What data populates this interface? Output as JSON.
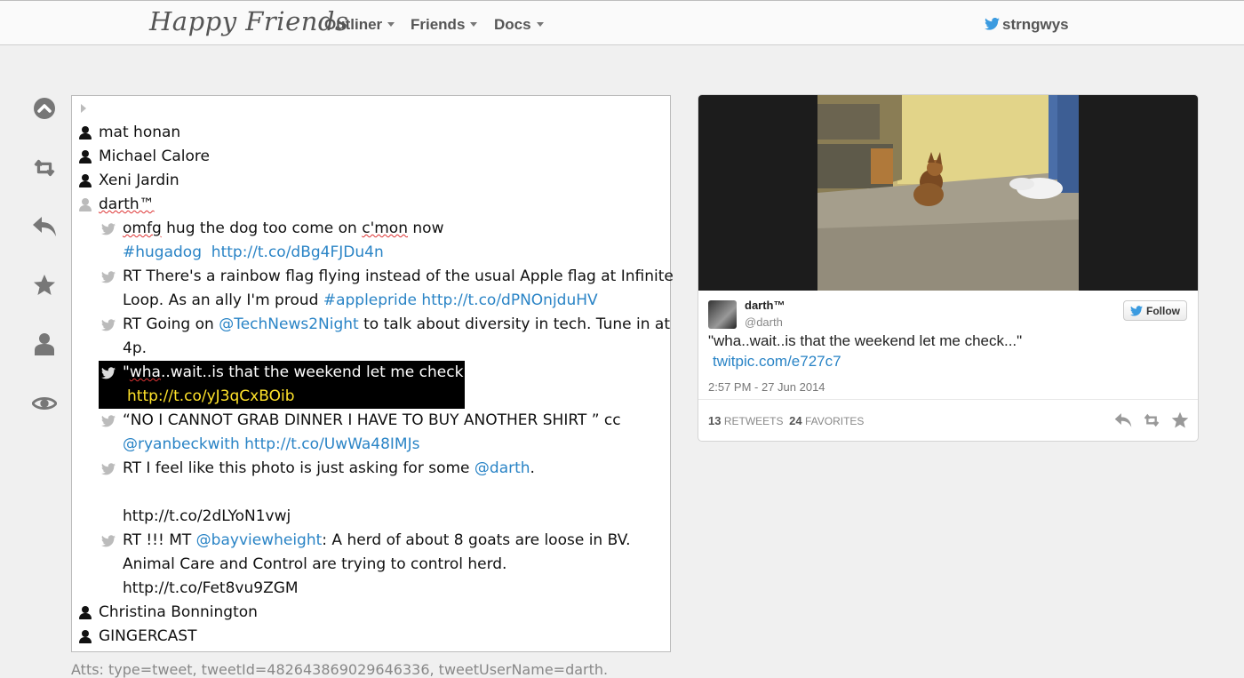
{
  "navbar": {
    "brand": "Happy Friends",
    "menus": [
      {
        "label": "Outliner"
      },
      {
        "label": "Friends"
      },
      {
        "label": "Docs"
      }
    ],
    "user": "strngwys"
  },
  "toolbar": {
    "icons": [
      "collapse-up-icon",
      "retweet-icon",
      "reply-icon",
      "star-icon",
      "user-icon",
      "eye-icon"
    ]
  },
  "outline": {
    "people": {
      "p1": "mat honan",
      "p2": "Michael Calore",
      "p3": "Xeni Jardin",
      "p4": "darth™",
      "p5": "Christina Bonnington",
      "p6": "GINGERCAST"
    },
    "tweets": {
      "t1_a": "omfg",
      "t1_b": " hug the dog too come on ",
      "t1_c": "c'mon",
      "t1_d": " now",
      "t1_tag": "#hugadog",
      "t1_url": "http://t.co/dBg4FJDu4n",
      "t2_l1": "RT There's a rainbow flag flying instead of the usual Apple flag at Infinite",
      "t2_l2": "Loop. As an ally I'm proud ",
      "t2_tag": "#applepride",
      "t2_url": "http://t.co/dPNOnjduHV",
      "t3_a": "RT Going on ",
      "t3_mention": "@TechNews2Night",
      "t3_b": " to talk about diversity in tech. Tune in at",
      "t3_l2": "4p.",
      "t4_a": "\"",
      "t4_b": "wha",
      "t4_c": "..wait..is that the weekend let me check...\"",
      "t4_url": "http://t.co/yJ3qCxBOib",
      "t5_l1": "“NO I CANNOT GRAB DINNER I HAVE TO BUY ANOTHER SHIRT ” cc",
      "t5_mention": "@ryanbeckwith",
      "t5_url": "http://t.co/UwWa48IMJs",
      "t6_a": "RT I feel like this photo is just asking for some ",
      "t6_mention": "@darth",
      "t6_b": ".",
      "t6_url": "http://t.co/2dLYoN1vwj",
      "t7_a": "RT !!! MT ",
      "t7_mention": "@bayviewheight",
      "t7_b": ": A herd of about 8 goats are loose in BV.",
      "t7_l2": "Animal Care and Control are trying to control herd.",
      "t7_url": "http://t.co/Fet8vu9ZGM"
    }
  },
  "atts": "Atts: type=tweet, tweetId=482643869029646336, tweetUserName=darth.",
  "card": {
    "name": "darth™",
    "handle": "@darth",
    "follow_label": "Follow",
    "text": "\"wha..wait..is that the weekend let me check...\"",
    "link": "twitpic.com/e727c7",
    "time": "2:57 PM - 27 Jun 2014",
    "retweets_count": "13",
    "retweets_label": "RETWEETS",
    "favorites_count": "24",
    "favorites_label": "FAVORITES"
  },
  "colors": {
    "link": "#2a84c6",
    "highlight_bg": "#000000",
    "highlight_link": "#ffe32a",
    "twitter": "#3b9be0"
  }
}
